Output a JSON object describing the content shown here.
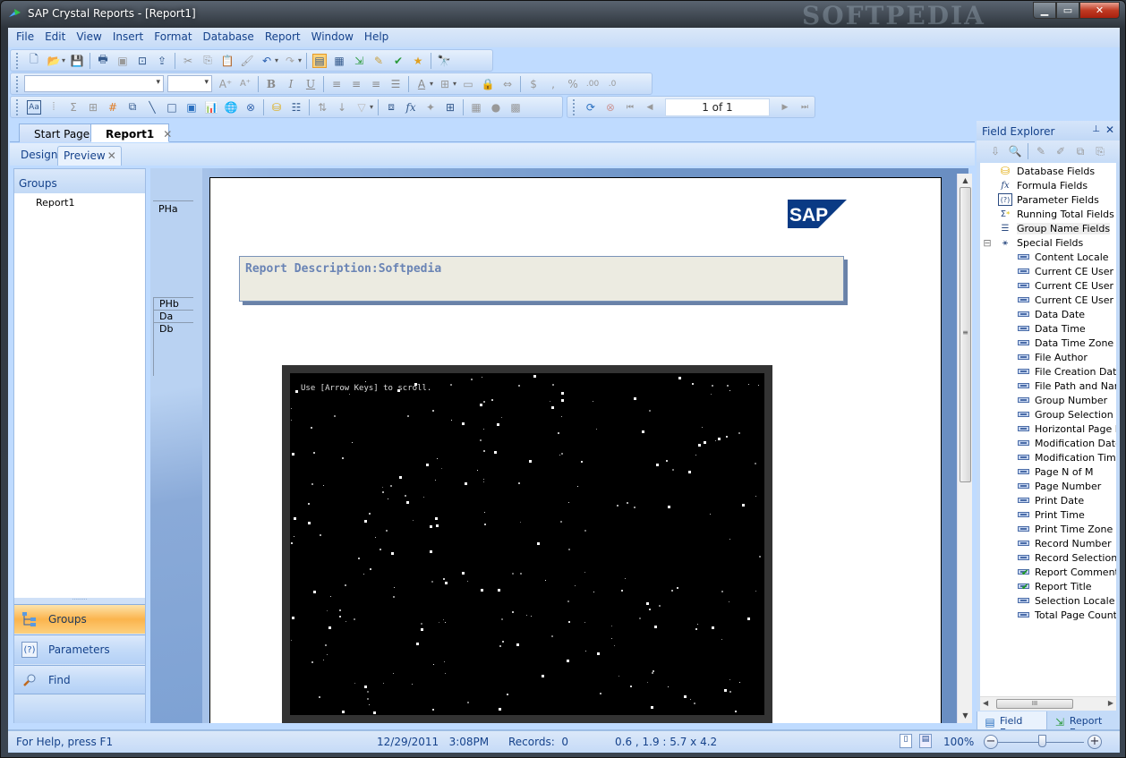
{
  "window": {
    "title": "SAP Crystal Reports - [Report1]",
    "watermark": "SOFTPEDIA",
    "controls": {
      "minimize": "▁",
      "maximize": "▭",
      "close": "✕"
    }
  },
  "menubar": {
    "items": [
      "File",
      "Edit",
      "View",
      "Insert",
      "Format",
      "Database",
      "Report",
      "Window",
      "Help"
    ]
  },
  "toolbar_standard": {
    "icons": [
      "new-icon",
      "open-icon",
      "save-icon",
      "print-icon",
      "print-preview-icon",
      "page-preview-icon",
      "export-icon",
      "cut-icon",
      "copy-icon",
      "paste-icon",
      "format-painter-icon",
      "undo-icon",
      "redo-icon",
      "design-view-icon",
      "report-sections-icon",
      "insert-field-icon",
      "expert-icon",
      "check-dependencies-icon",
      "repository-icon",
      "find-icon"
    ]
  },
  "toolbar_formatting": {
    "font_name": "",
    "font_size": "",
    "icons": [
      "increase-font-icon",
      "decrease-font-icon",
      "bold-icon",
      "italic-icon",
      "underline-icon",
      "align-left-icon",
      "align-center-icon",
      "align-right-icon",
      "justify-icon",
      "font-color-icon",
      "borders-icon",
      "suppress-icon",
      "lock-format-icon",
      "lock-size-icon",
      "currency-icon",
      "thousands-icon",
      "percent-icon",
      "increase-decimals-icon",
      "decrease-decimals-icon"
    ]
  },
  "toolbar_insert": {
    "icons": [
      "text-object-icon",
      "group-icon",
      "summary-icon",
      "cross-tab-icon",
      "olap-icon",
      "subreport-icon",
      "line-icon",
      "box-icon",
      "picture-icon",
      "chart-icon",
      "map-icon",
      "flash-icon",
      "database-expert-icon",
      "record-sort-icon",
      "group-expert-icon",
      "sort-expert-icon",
      "select-expert-icon",
      "section-expert-icon",
      "formula-icon",
      "highlight-expert-icon",
      "grid-icon",
      "cross-tab-expert-icon",
      "hyperlink-icon",
      "template-icon"
    ]
  },
  "toolbar_navigation": {
    "page_indicator": "1 of 1",
    "icons": [
      "refresh-icon",
      "stop-icon",
      "first-page-icon",
      "previous-page-icon",
      "next-page-icon",
      "last-page-icon"
    ]
  },
  "doc_tabs": [
    {
      "label": "Start Page",
      "active": false
    },
    {
      "label": "Report1",
      "active": true,
      "close": "✕"
    }
  ],
  "view_tabs": [
    {
      "label": "Design",
      "active": false
    },
    {
      "label": "Preview",
      "active": true,
      "close": "✕"
    }
  ],
  "left_panel": {
    "header": "Groups",
    "tree": [
      "Report1"
    ],
    "splitter": "·········",
    "nav_buttons": [
      {
        "label": "Groups",
        "icon": "groups-tree-icon",
        "selected": true
      },
      {
        "label": "Parameters",
        "icon": "parameters-icon",
        "selected": false
      },
      {
        "label": "Find",
        "icon": "magnifier-icon",
        "selected": false
      }
    ]
  },
  "preview": {
    "sections": [
      "PHa",
      "PHb",
      "Da",
      "Db"
    ],
    "logo": "SAP",
    "description": "Report Description:Softpedia",
    "flash_hint": "Use [Arrow Keys] to scroll."
  },
  "field_explorer": {
    "title": "Field Explorer",
    "pin": "📌",
    "close": "✕",
    "toolbar_icons": [
      "insert-to-report-icon",
      "browse-icon",
      "new-icon",
      "edit-icon",
      "duplicate-icon",
      "rename-icon"
    ],
    "categories": [
      {
        "label": "Database Fields",
        "icon": "database-icon"
      },
      {
        "label": "Formula Fields",
        "icon": "formula-icon"
      },
      {
        "label": "Parameter Fields",
        "icon": "parameter-icon"
      },
      {
        "label": "Running Total Fields",
        "icon": "running-total-icon"
      },
      {
        "label": "Group Name Fields",
        "icon": "group-name-icon"
      },
      {
        "label": "Special Fields",
        "icon": "special-fields-icon",
        "expanded": true,
        "expander": "⊟"
      }
    ],
    "special_fields": [
      {
        "label": "Content Locale",
        "checked": false
      },
      {
        "label": "Current CE User ID",
        "checked": false
      },
      {
        "label": "Current CE User Name",
        "checked": false
      },
      {
        "label": "Current CE User Time Zone",
        "checked": false
      },
      {
        "label": "Data Date",
        "checked": false
      },
      {
        "label": "Data Time",
        "checked": false
      },
      {
        "label": "Data Time Zone",
        "checked": false
      },
      {
        "label": "File Author",
        "checked": false
      },
      {
        "label": "File Creation Date",
        "checked": false
      },
      {
        "label": "File Path and Name",
        "checked": false
      },
      {
        "label": "Group Number",
        "checked": false
      },
      {
        "label": "Group Selection Formula",
        "checked": false
      },
      {
        "label": "Horizontal Page Number",
        "checked": false
      },
      {
        "label": "Modification Date",
        "checked": false
      },
      {
        "label": "Modification Time",
        "checked": false
      },
      {
        "label": "Page N of M",
        "checked": false
      },
      {
        "label": "Page Number",
        "checked": false
      },
      {
        "label": "Print Date",
        "checked": false
      },
      {
        "label": "Print Time",
        "checked": false
      },
      {
        "label": "Print Time Zone",
        "checked": false
      },
      {
        "label": "Record Number",
        "checked": false
      },
      {
        "label": "Record Selection Formula",
        "checked": false
      },
      {
        "label": "Report Comments",
        "checked": true
      },
      {
        "label": "Report Title",
        "checked": true
      },
      {
        "label": "Selection Locale",
        "checked": false
      },
      {
        "label": "Total Page Count",
        "checked": false
      }
    ],
    "bottom_tabs": [
      {
        "label": "Field Ex...",
        "active": true
      },
      {
        "label": "Report E...",
        "active": false
      }
    ],
    "hscroll_grip": "III"
  },
  "statusbar": {
    "help": "For Help, press F1",
    "datetime": "12/29/2011   3:08PM",
    "records": "Records:  0",
    "position": "0.6 , 1.9 : 5.7 x 4.2",
    "zoom": "100%",
    "zoom_level_percent": 100,
    "zoom_out": "−",
    "zoom_in": "+"
  },
  "colors": {
    "ribbon_bg": "#bfdbff",
    "text_blue": "#15428b",
    "selected_nav": "#fbb44d",
    "sap_blue": "#0a3a84",
    "description_text": "#6a84b5"
  }
}
